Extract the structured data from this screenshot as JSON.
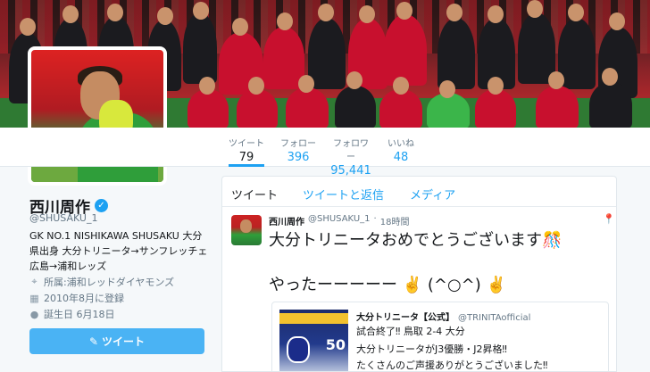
{
  "profile": {
    "name": "西川周作",
    "handle": "@SHUSAKU_1",
    "bio": "GK NO.1 NISHIKAWA SHUSAKU 大分県出身 大分トリニータ→サンフレッチェ広島→浦和レッズ",
    "affiliation": "所属:浦和レッドダイヤモンズ",
    "joined": "2010年8月に登録",
    "birthday": "誕生日 6月18日",
    "tweet_button": "ツイート"
  },
  "stats": [
    {
      "label": "ツイート",
      "value": "79"
    },
    {
      "label": "フォロー",
      "value": "396"
    },
    {
      "label": "フォロワー",
      "value": "95,441"
    },
    {
      "label": "いいね",
      "value": "48"
    }
  ],
  "tabs": [
    "ツイート",
    "ツイートと返信",
    "メディア"
  ],
  "tweet": {
    "name": "西川周作",
    "handle": "@SHUSAKU_1",
    "time": "18時間",
    "line1": "大分トリニータおめでとうございます🎊",
    "line2": "やったーーーーー ✌️ (^○^) ✌️",
    "quote": {
      "name": "大分トリニータ【公式】",
      "handle": "@TRINITAofficial",
      "line1": "試合終了‼︎ 鳥取 2-4 大分",
      "line2": "大分トリニータがJ3優勝・J2昇格‼︎",
      "line3": "たくさんのご声援ありがとうございました‼︎",
      "image_number": "50"
    }
  },
  "colors": {
    "accent": "#1da1f2",
    "button": "#4ab3f4",
    "text": "#14171a",
    "muted": "#657786"
  }
}
